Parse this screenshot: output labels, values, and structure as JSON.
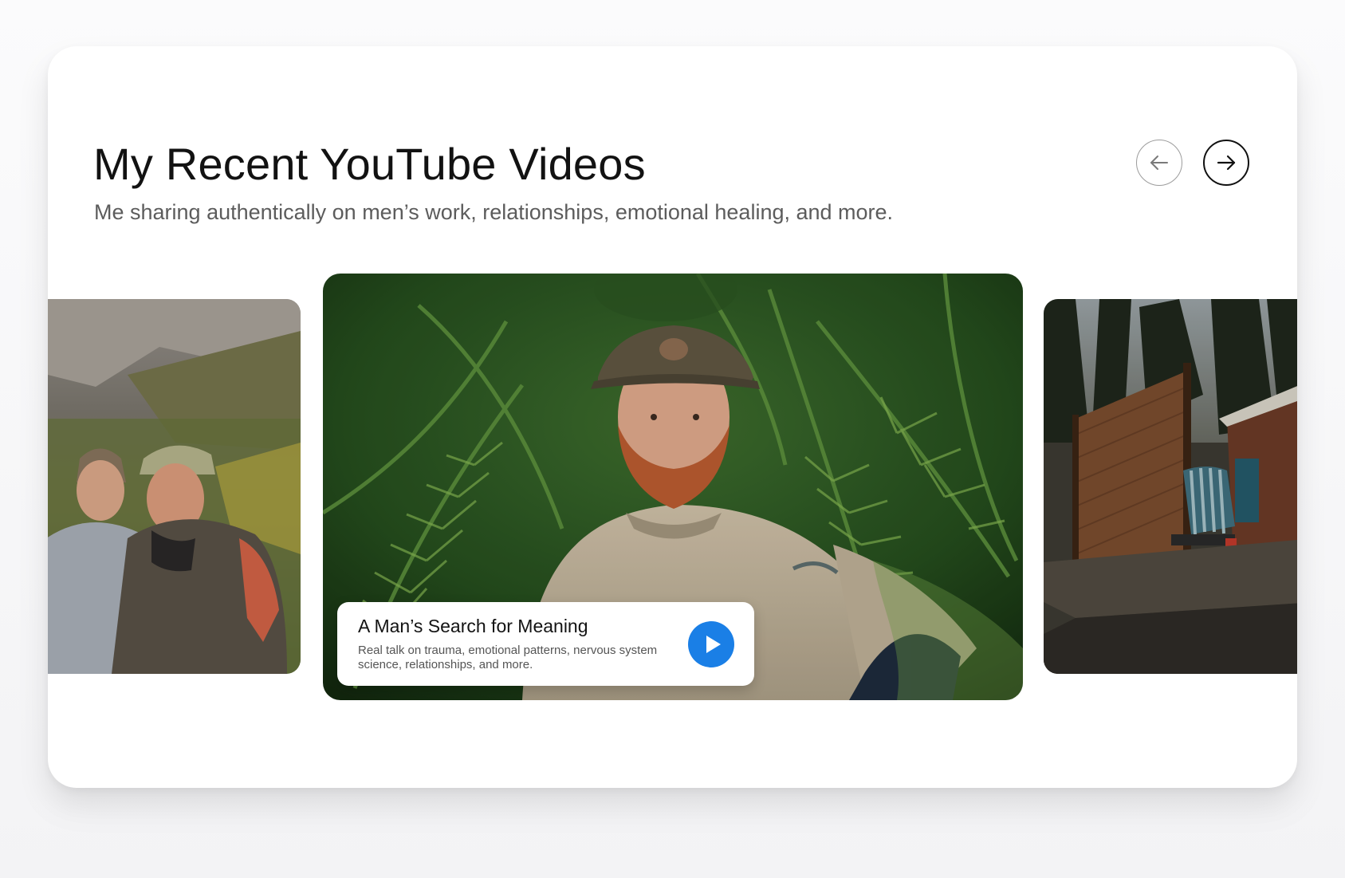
{
  "section": {
    "title": "My Recent YouTube Videos",
    "subtitle": "Me sharing authentically on men’s work, relationships, emotional healing, and more."
  },
  "nav": {
    "prev_icon": "arrow-left-icon",
    "next_icon": "arrow-right-icon"
  },
  "featured_video": {
    "title": "A Man’s Search for Meaning",
    "description": "Real talk on trauma, emotional patterns, nervous system science, relationships, and more.",
    "play_icon": "play-icon"
  },
  "colors": {
    "accent": "#1a7fe6",
    "title_text": "#121212",
    "subtitle_text": "#5c5c5c"
  }
}
